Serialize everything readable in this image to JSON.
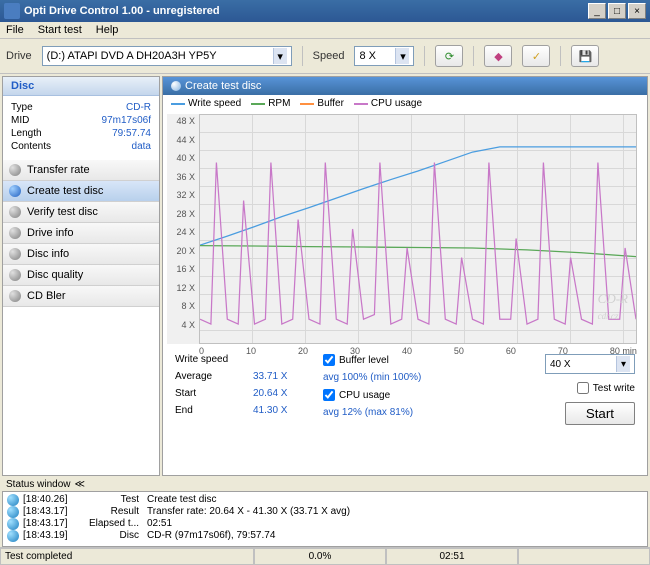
{
  "window": {
    "title": "Opti Drive Control 1.00 - unregistered"
  },
  "menu": {
    "file": "File",
    "start": "Start test",
    "help": "Help"
  },
  "toolbar": {
    "drive_label": "Drive",
    "drive_value": "(D:)  ATAPI DVD A  DH20A3H YP5Y",
    "speed_label": "Speed",
    "speed_value": "8 X"
  },
  "disc": {
    "header": "Disc",
    "type_l": "Type",
    "type_v": "CD-R",
    "mid_l": "MID",
    "mid_v": "97m17s06f",
    "length_l": "Length",
    "length_v": "79:57.74",
    "contents_l": "Contents",
    "contents_v": "data"
  },
  "nav": {
    "transfer": "Transfer rate",
    "create": "Create test disc",
    "verify": "Verify test disc",
    "driveinfo": "Drive info",
    "discinfo": "Disc info",
    "quality": "Disc quality",
    "bler": "CD Bler"
  },
  "chart": {
    "title": "Create test disc",
    "legend": {
      "write": "Write speed",
      "rpm": "RPM",
      "buffer": "Buffer",
      "cpu": "CPU usage"
    },
    "xunit": "min"
  },
  "chart_data": {
    "type": "line",
    "xlabel": "min",
    "ylabel": "X",
    "xlim": [
      0,
      80
    ],
    "ylim": [
      0,
      48
    ],
    "yticks": [
      4,
      8,
      12,
      16,
      20,
      24,
      28,
      32,
      36,
      40,
      44,
      48
    ],
    "xticks": [
      0,
      10,
      20,
      30,
      40,
      50,
      60,
      70,
      80
    ],
    "series": [
      {
        "name": "Write speed",
        "color": "#4a9de0",
        "x": [
          0,
          5,
          10,
          15,
          20,
          25,
          30,
          35,
          40,
          45,
          50,
          55,
          60,
          65,
          70,
          75,
          80
        ],
        "values": [
          20.6,
          22.5,
          24.5,
          26.6,
          28.5,
          30.5,
          32.5,
          34.4,
          36.2,
          38.2,
          40.2,
          41.3,
          41.3,
          41.3,
          41.3,
          41.3,
          41.3
        ]
      },
      {
        "name": "RPM",
        "color": "#5aa858",
        "x": [
          0,
          10,
          20,
          30,
          40,
          50,
          60,
          70,
          80
        ],
        "values": [
          20.5,
          20.4,
          20.3,
          20.2,
          20.1,
          20.0,
          19.6,
          19.0,
          18.2
        ]
      },
      {
        "name": "CPU usage",
        "color": "#c878c8",
        "x": [
          0,
          2,
          3,
          5,
          7,
          8,
          10,
          12,
          13,
          15,
          17,
          18,
          20,
          22,
          23,
          25,
          27,
          28,
          30,
          32,
          33,
          35,
          37,
          38,
          40,
          42,
          43,
          45,
          47,
          48,
          50,
          52,
          53,
          55,
          57,
          58,
          60,
          62,
          63,
          65,
          67,
          68,
          70,
          72,
          73,
          75,
          77,
          78,
          80
        ],
        "values": [
          5,
          4,
          38,
          5,
          4,
          30,
          4,
          5,
          38,
          4,
          5,
          26,
          5,
          4,
          38,
          5,
          4,
          24,
          5,
          6,
          38,
          4,
          5,
          20,
          5,
          4,
          38,
          5,
          4,
          18,
          5,
          4,
          38,
          5,
          5,
          22,
          4,
          5,
          38,
          5,
          4,
          18,
          5,
          4,
          38,
          5,
          5,
          20,
          5
        ],
        "note": "avg 12%, max 81%"
      },
      {
        "name": "Buffer",
        "color": "#ff9040",
        "note": "avg 100% (min 100%)"
      }
    ]
  },
  "stats": {
    "write_label": "Write speed",
    "avg_l": "Average",
    "avg_v": "33.71 X",
    "start_l": "Start",
    "start_v": "20.64 X",
    "end_l": "End",
    "end_v": "41.30 X",
    "buffer_cb": "Buffer level",
    "buffer_avg": "avg 100% (min 100%)",
    "cpu_cb": "CPU usage",
    "cpu_avg": "avg 12% (max 81%)",
    "speed_sel": "40 X",
    "testwrite_cb": "Test write",
    "start_btn": "Start"
  },
  "status_header": "Status window",
  "log": [
    {
      "time": "[18:40.26]",
      "key": "Test",
      "val": "Create test disc"
    },
    {
      "time": "[18:43.17]",
      "key": "Result",
      "val": "Transfer rate: 20.64 X - 41.30 X (33.71 X avg)"
    },
    {
      "time": "[18:43.17]",
      "key": "Elapsed t...",
      "val": "02:51"
    },
    {
      "time": "[18:43.19]",
      "key": "Disc",
      "val": "CD-R (97m17s06f), 79:57.74"
    }
  ],
  "statusbar": {
    "status": "Test completed",
    "pct": "0.0%",
    "time": "02:51"
  }
}
